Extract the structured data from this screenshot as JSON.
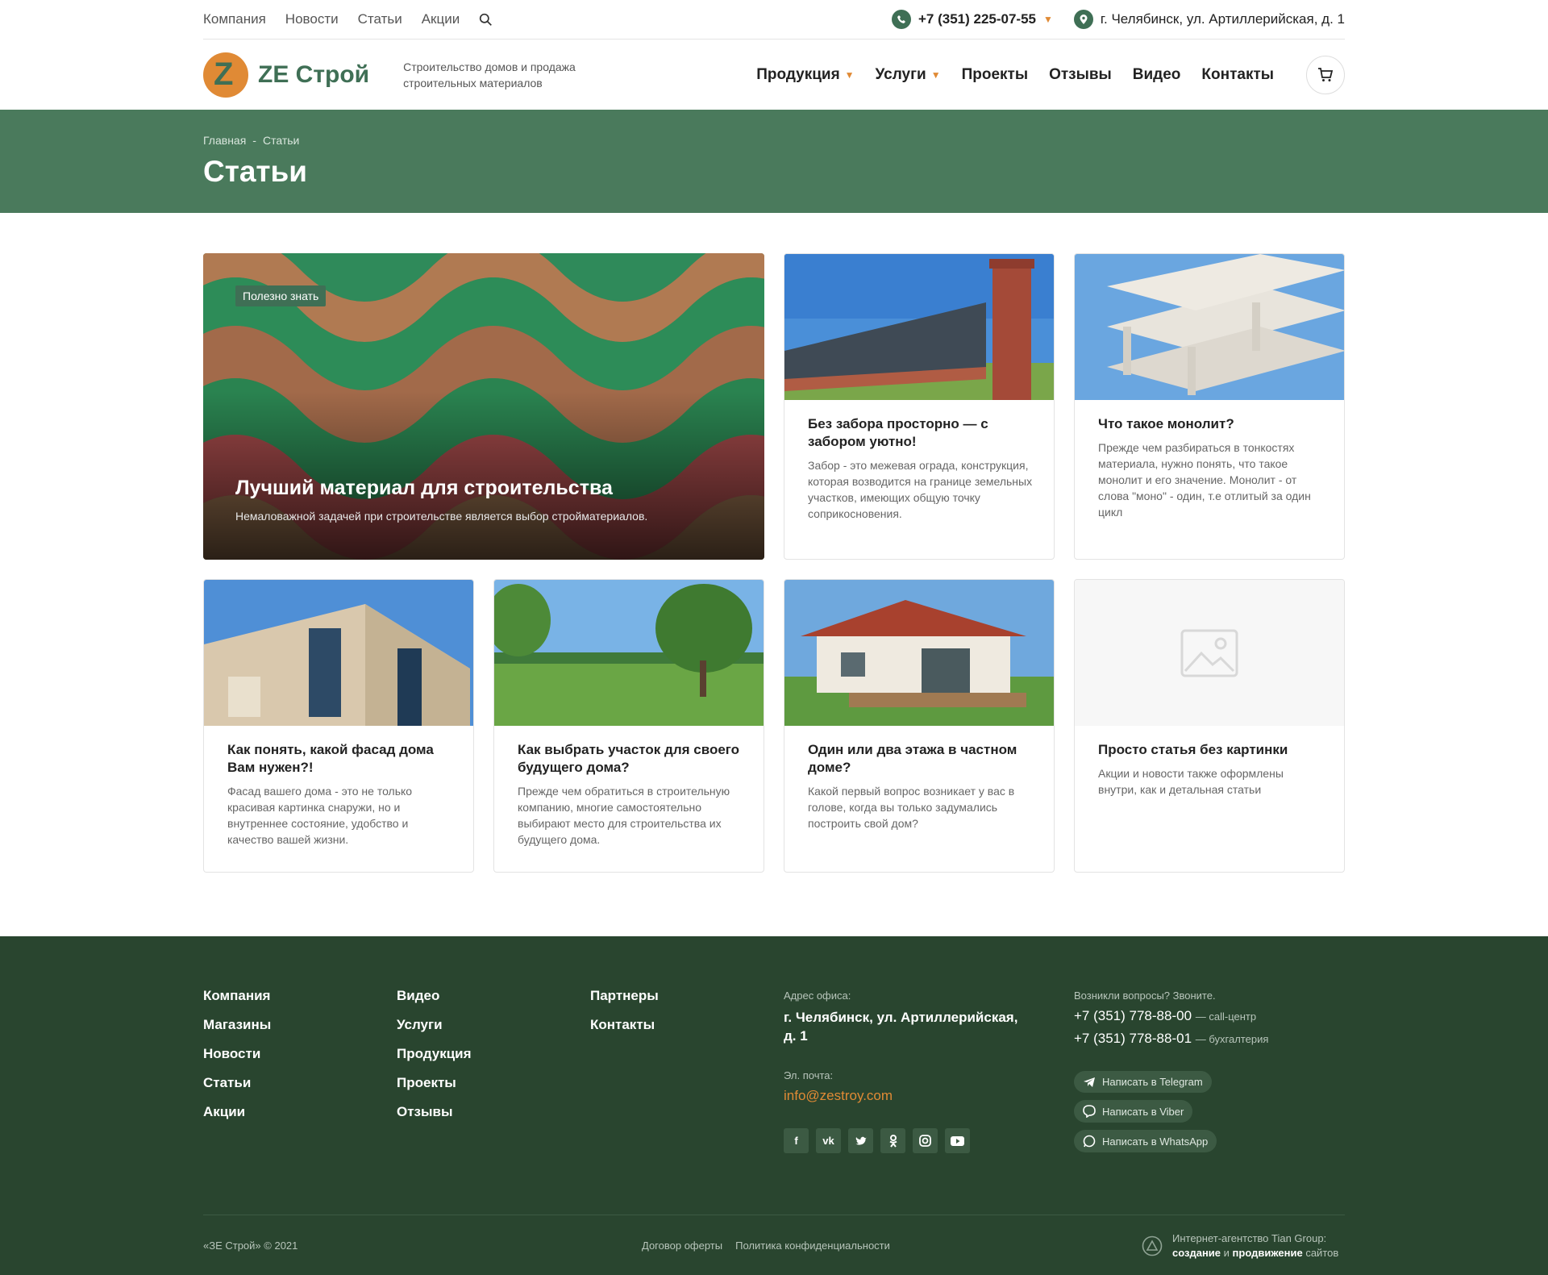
{
  "topbar": {
    "nav": [
      "Компания",
      "Новости",
      "Статьи",
      "Акции"
    ],
    "phone": "+7 (351) 225-07-55",
    "address": "г. Челябинск, ул. Артиллерийская, д. 1"
  },
  "header": {
    "logo_text": "ZE Строй",
    "tagline": "Строительство домов и продажа строительных материалов",
    "nav": [
      "Продукция",
      "Услуги",
      "Проекты",
      "Отзывы",
      "Видео",
      "Контакты"
    ]
  },
  "banner": {
    "breadcrumb": [
      "Главная",
      "Статьи"
    ],
    "title": "Статьи"
  },
  "feature": {
    "tag": "Полезно знать",
    "title": "Лучший материал для строительства",
    "text": "Немаловажной задачей при строительстве является выбор стройматериалов."
  },
  "articles": [
    {
      "title": "Без забора просторно — с забором уютно!",
      "text": "Забор - это межевая ограда, конструкция, которая возводится на границе земельных участков, имеющих общую точку соприкосновения."
    },
    {
      "title": "Что такое монолит?",
      "text": "Прежде чем разбираться в тонкостях материала, нужно понять, что такое монолит и его значение. Монолит - от слова \"моно\" - один, т.е отлитый за один цикл"
    },
    {
      "title": "Как понять, какой фасад дома Вам нужен?!",
      "text": "Фасад вашего дома - это не только красивая картинка снаружи, но и внутреннее состояние, удобство и качество вашей жизни."
    },
    {
      "title": "Как выбрать участок для своего будущего дома?",
      "text": "Прежде чем обратиться в строительную компанию, многие самостоятельно выбирают место для строительства их будущего дома."
    },
    {
      "title": "Один или два этажа в частном доме?",
      "text": "Какой первый вопрос возникает у вас в голове,  когда вы только задумались построить свой дом?"
    },
    {
      "title": "Просто статья без картинки",
      "text": "Акции и новости также оформлены внутри, как и детальная статьи"
    }
  ],
  "footer": {
    "col1": [
      "Компания",
      "Магазины",
      "Новости",
      "Статьи",
      "Акции"
    ],
    "col2": [
      "Видео",
      "Услуги",
      "Продукция",
      "Проекты",
      "Отзывы"
    ],
    "col3": [
      "Партнеры",
      "Контакты"
    ],
    "office_label": "Адрес офиса:",
    "office_address": "г. Челябинск, ул. Артиллерийская, д. 1",
    "email_label": "Эл. почта:",
    "email": "info@zestroy.com",
    "questions_label": "Возникли вопросы? Звоните.",
    "phone1": "+7 (351) 778-88-00",
    "phone1_note": "— call-центр",
    "phone2": "+7 (351) 778-88-01",
    "phone2_note": "— бухгалтерия",
    "telegram": "Написать в Telegram",
    "viber": "Написать в Viber",
    "whatsapp": "Написать в WhatsApp",
    "copyright": "«ЗЕ Строй» © 2021",
    "offer": "Договор оферты",
    "privacy": "Политика конфиденциальности",
    "agency_line1": "Интернет-агентство Tian Group:",
    "agency_create": "создание",
    "agency_and": "и",
    "agency_promo": "продвижение",
    "agency_sites": "сайтов"
  },
  "colors": {
    "brand_green": "#3f6f55",
    "accent_orange": "#e08a35",
    "footer_bg": "#29452f"
  }
}
